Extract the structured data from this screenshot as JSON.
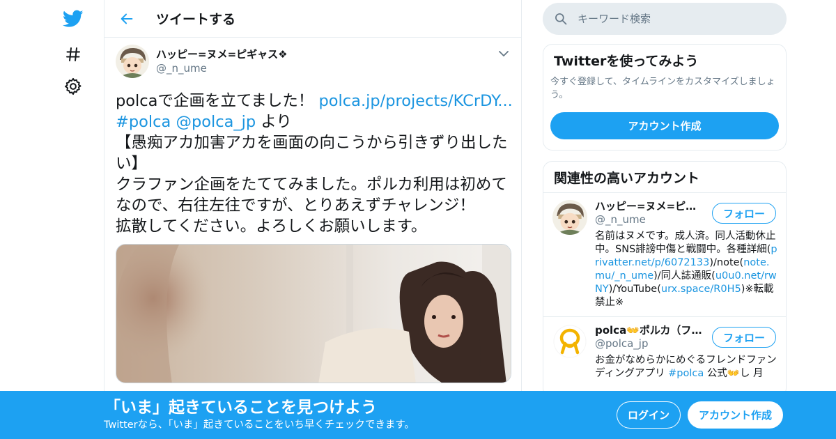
{
  "colors": {
    "brand": "#1da1f2",
    "link": "#1b95e0",
    "text": "#14171a",
    "muted": "#657786",
    "border": "#e6ecf0"
  },
  "nav": {
    "icons": [
      "twitter-bird-icon",
      "hashtag-icon",
      "gear-icon"
    ]
  },
  "header": {
    "title": "ツイートする",
    "back_icon": "arrow-left-icon"
  },
  "tweet": {
    "author_name": "ハッピー=ヌメ=ピギャス❖",
    "author_handle": "@_n_ume",
    "line1_text": "polcaで企画を立てました！ ",
    "line1_link": "polca.jp/projects/KCrDY...",
    "hashtag": "#polca",
    "mention": "@polca_jp",
    "line2_suffix": " より",
    "body": "\n【愚痴アカ加害アカを画面の向こうから引きずり出したい】\nクラファン企画をたててみました。ポルカ利用は初めてなので、右往左往ですが、とりあえずチャレンジ！\n拡散してください。よろしくお願いします。"
  },
  "search": {
    "placeholder": "キーワード検索"
  },
  "signup_card": {
    "title": "Twitterを使ってみよう",
    "description": "今すぐ登録して、タイムラインをカスタマイズしましょう。",
    "button_label": "アカウント作成"
  },
  "related": {
    "title": "関連性の高いアカウント",
    "follow_label": "フォロー",
    "accounts": [
      {
        "name": "ハッピー=ヌメ=ピギャス❖",
        "handle": "@_n_ume",
        "bio_1": "名前はヌメです。成人済。同人活動休止中。SNS誹謗中傷と戦闘中。各種詳細(",
        "link_1": "privatter.net/p/6072133",
        "bio_2": ")/note(",
        "link_2": "note.mu/_n_ume",
        "bio_3": ")/同人誌通販(",
        "link_3": "u0u0.net/rwNY",
        "bio_4": ")/YouTube(",
        "link_4": "urx.space/R0H5",
        "bio_5": ")※転載禁止※"
      },
      {
        "name": "polca👐ポルカ（フレンドファンディング）",
        "handle": "@polca_jp",
        "bio_1": "お金がなめらかにめぐるフレンドファンディングアプリ ",
        "link_1": "#polca",
        "bio_2": " 公式👐し 月"
      }
    ]
  },
  "bottom_bar": {
    "title": "「いま」起きていることを見つけよう",
    "subtitle": "Twitterなら、「いま」起きていることをいち早くチェックできます。",
    "login_label": "ログイン",
    "signup_label": "アカウント作成"
  }
}
